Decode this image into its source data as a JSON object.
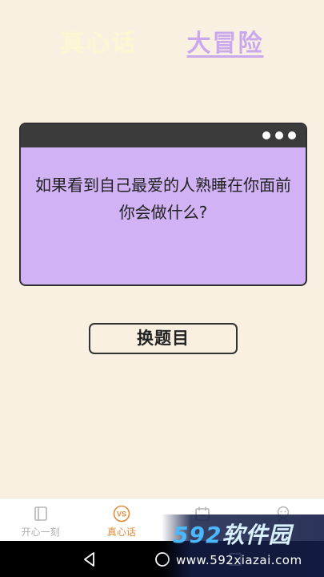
{
  "tabs": {
    "truth": "真心话",
    "dare": "大冒险"
  },
  "card": {
    "question": "如果看到自己最爱的人熟睡在你面前你会做什么?"
  },
  "switch_button": "换题目",
  "bottom_nav": [
    {
      "label": "开心一刻",
      "icon": "book-icon"
    },
    {
      "label": "真心话",
      "icon": "vs-icon"
    },
    {
      "label": "",
      "icon": "calendar-icon"
    },
    {
      "label": "",
      "icon": "face-icon"
    }
  ],
  "watermark": {
    "brand_num": "592",
    "brand_text": "软件园",
    "url": "www.592xiazai.com"
  },
  "colors": {
    "background": "#faf0e1",
    "accent_purple": "#c9a8ee",
    "card": "#d1b2f5",
    "nav_active": "#e08a3a"
  }
}
